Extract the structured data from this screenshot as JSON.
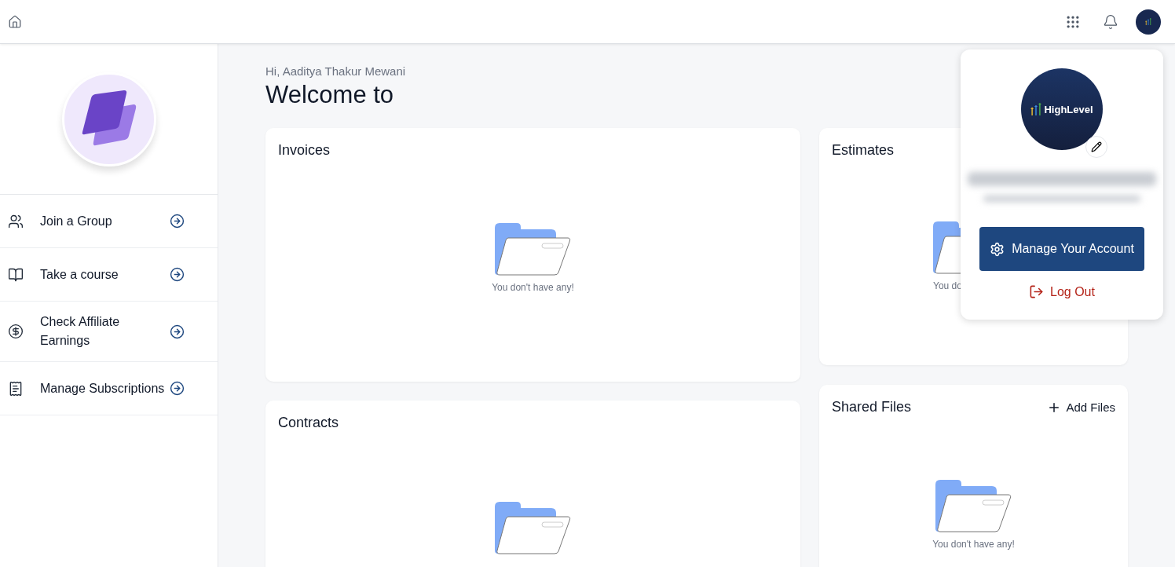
{
  "sidebar": {
    "items": [
      {
        "label": "Join a Group",
        "kind": "group"
      },
      {
        "label": "Take a course",
        "kind": "course"
      },
      {
        "label": "Check Affiliate Earnings",
        "kind": "earnings"
      },
      {
        "label": "Manage Subscriptions",
        "kind": "subscriptions"
      }
    ]
  },
  "greeting": "Hi, Aaditya Thakur Mewani",
  "heading": "Welcome to",
  "left_column": [
    {
      "title": "Invoices",
      "empty_text": "You don't have any!",
      "partly_hidden": false
    },
    {
      "title": "Contracts",
      "partly_hidden": false
    }
  ],
  "right_column": [
    {
      "title": "Estimates",
      "empty_text": "You do",
      "partly_hidden": true
    },
    {
      "title": "Shared Files",
      "action": "Add Files",
      "empty_text": "You don't have any!",
      "partly_hidden": false
    }
  ],
  "account_menu": {
    "logo_text": "HighLevel",
    "manage_button": "Manage Your Account",
    "logout": "Log Out"
  }
}
